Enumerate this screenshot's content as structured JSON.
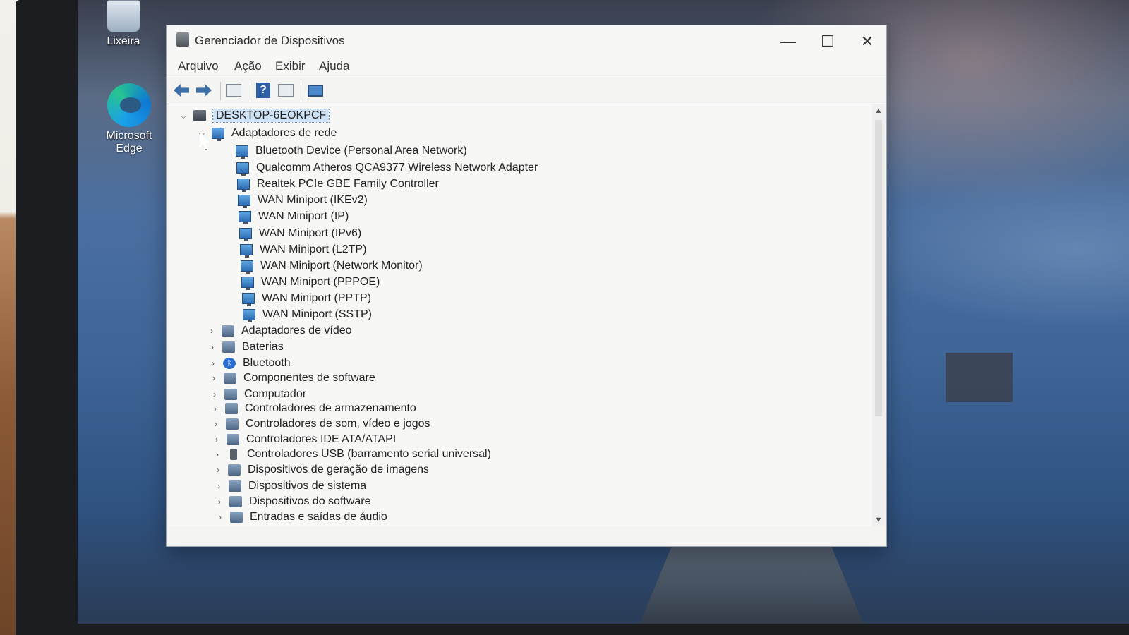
{
  "desktop": {
    "icons": [
      {
        "label": "Lixeira",
        "icon": "recycle-bin-icon"
      },
      {
        "label": "Microsoft Edge",
        "icon": "edge-icon"
      }
    ]
  },
  "window": {
    "title": "Gerenciador de Dispositivos",
    "controls": {
      "minimize": "—",
      "maximize": "☐",
      "close": "✕"
    },
    "menu": [
      "Arquivo",
      "Ação",
      "Exibir",
      "Ajuda"
    ],
    "toolbar": [
      {
        "icon": "back-arrow-icon"
      },
      {
        "icon": "forward-arrow-icon"
      },
      {
        "icon": "show-hide-console-tree-icon"
      },
      {
        "icon": "help-icon",
        "glyph": "?"
      },
      {
        "icon": "properties-panel-icon"
      },
      {
        "icon": "monitor-icon"
      }
    ]
  },
  "tree": {
    "root": "DESKTOP-6EOKPCF",
    "expanded_category": "Adaptadores de rede",
    "network_adapters": [
      "Bluetooth Device (Personal Area Network)",
      "Qualcomm Atheros QCA9377 Wireless Network Adapter",
      "Realtek PCIe GBE Family Controller",
      "WAN Miniport (IKEv2)",
      "WAN Miniport (IP)",
      "WAN Miniport (IPv6)",
      "WAN Miniport (L2TP)",
      "WAN Miniport (Network Monitor)",
      "WAN Miniport (PPPOE)",
      "WAN Miniport (PPTP)",
      "WAN Miniport (SSTP)"
    ],
    "categories": [
      {
        "label": "Adaptadores de vídeo",
        "icon": "display-adapter-icon"
      },
      {
        "label": "Baterias",
        "icon": "battery-icon"
      },
      {
        "label": "Bluetooth",
        "icon": "bluetooth-icon"
      },
      {
        "label": "Componentes de software",
        "icon": "software-component-icon"
      },
      {
        "label": "Computador",
        "icon": "computer-icon"
      },
      {
        "label": "Controladores de armazenamento",
        "icon": "storage-controller-icon"
      },
      {
        "label": "Controladores de som, vídeo e jogos",
        "icon": "sound-icon"
      },
      {
        "label": "Controladores IDE ATA/ATAPI",
        "icon": "ide-controller-icon"
      },
      {
        "label": "Controladores USB (barramento serial universal)",
        "icon": "usb-icon"
      },
      {
        "label": "Dispositivos de geração de imagens",
        "icon": "imaging-device-icon"
      },
      {
        "label": "Dispositivos de sistema",
        "icon": "system-device-icon"
      },
      {
        "label": "Dispositivos do software",
        "icon": "software-device-icon"
      },
      {
        "label": "Entradas e saídas de áudio",
        "icon": "audio-io-icon"
      }
    ]
  },
  "colors": {
    "selection": "#cfe3f7",
    "window_bg": "#f7f7f6",
    "accent_icon": "#2d6db4"
  }
}
